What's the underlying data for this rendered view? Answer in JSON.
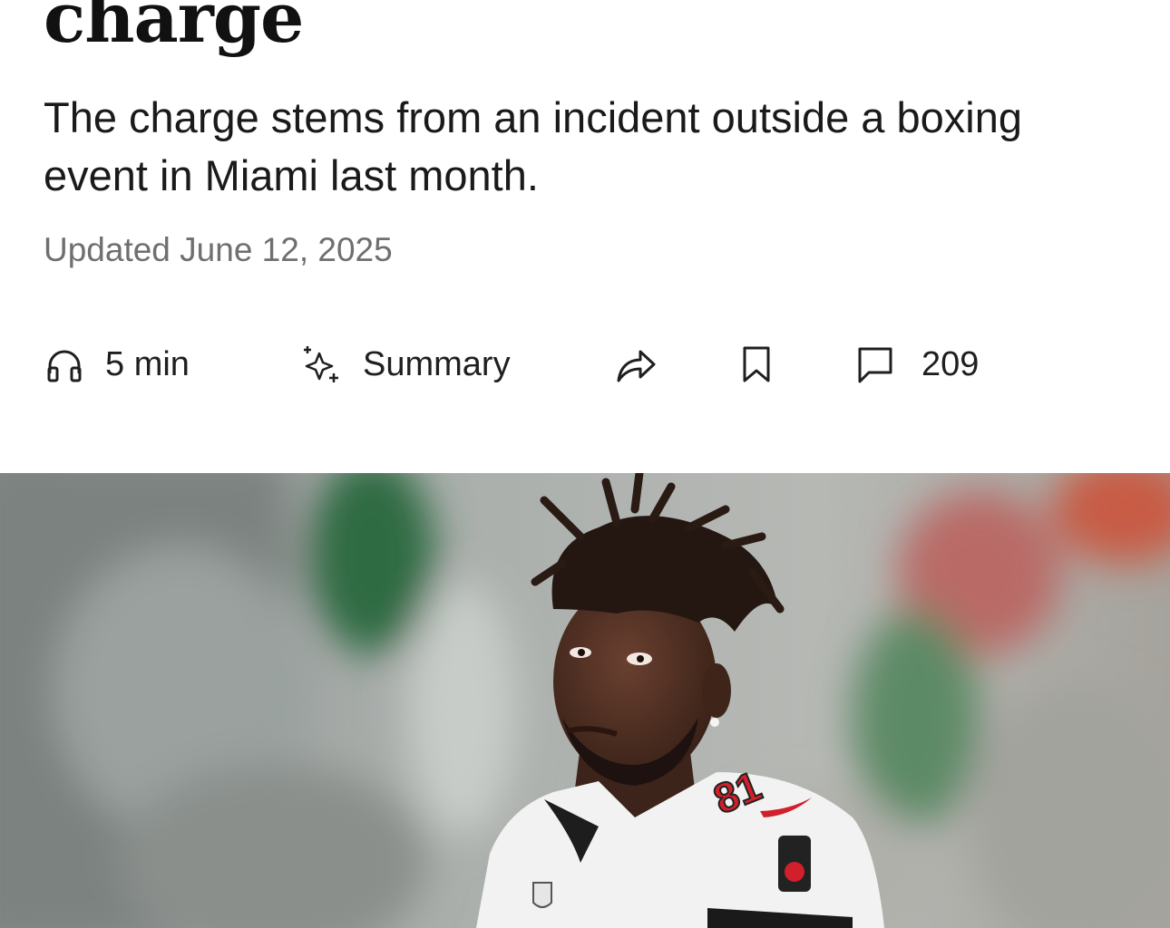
{
  "article": {
    "headline_fragment": "charge",
    "dek": "The charge stems from an incident outside a boxing event in Miami last month.",
    "updated": "Updated June 12, 2025"
  },
  "toolbar": {
    "listen": {
      "icon": "headphones-icon",
      "label": "5 min"
    },
    "summary": {
      "icon": "sparkle-icon",
      "label": "Summary"
    },
    "share": {
      "icon": "share-arrow-icon"
    },
    "save": {
      "icon": "bookmark-icon"
    },
    "comments": {
      "icon": "comment-icon",
      "count": "209"
    }
  },
  "hero_image": {
    "alt": "Football player in a white Tampa Bay Buccaneers jersey",
    "jersey_number": "81",
    "colors": {
      "jersey": "#f4f4f4",
      "accent": "#d11f2b",
      "skin": "#4a2c20"
    }
  }
}
